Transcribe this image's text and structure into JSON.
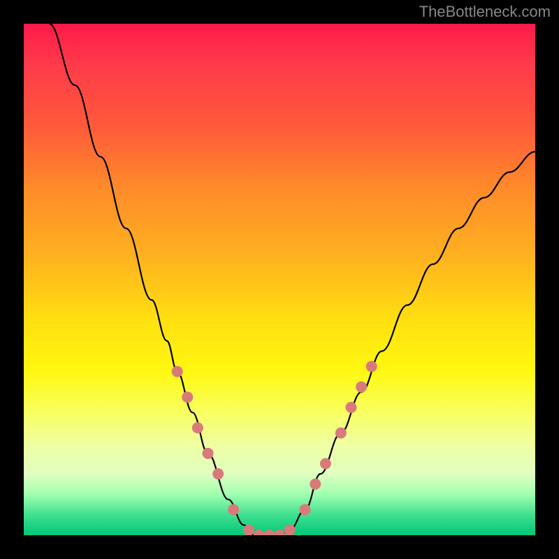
{
  "watermark": "TheBottleneck.com",
  "chart_data": {
    "type": "line",
    "title": "",
    "xlabel": "",
    "ylabel": "",
    "xlim": [
      0,
      100
    ],
    "ylim": [
      0,
      100
    ],
    "gradient_stops": [
      {
        "pos": 0,
        "color": "#ff1a4a"
      },
      {
        "pos": 20,
        "color": "#ff5a3a"
      },
      {
        "pos": 45,
        "color": "#ffb020"
      },
      {
        "pos": 68,
        "color": "#fff810"
      },
      {
        "pos": 88,
        "color": "#e0ffc0"
      },
      {
        "pos": 100,
        "color": "#00c878"
      }
    ],
    "series": [
      {
        "name": "bottleneck-curve",
        "color": "#000000",
        "x": [
          5,
          10,
          15,
          20,
          25,
          28,
          30,
          33,
          36,
          40,
          43,
          45,
          48,
          50,
          52,
          55,
          58,
          62,
          66,
          70,
          75,
          80,
          85,
          90,
          95,
          100
        ],
        "y": [
          100,
          88,
          74,
          60,
          46,
          38,
          32,
          24,
          16,
          7,
          2,
          0,
          0,
          0,
          1,
          5,
          12,
          20,
          28,
          36,
          45,
          53,
          60,
          66,
          71,
          75
        ]
      }
    ],
    "markers": {
      "name": "highlight-dots",
      "color": "#d97a7a",
      "radius": 8,
      "points": [
        {
          "x": 30,
          "y": 32
        },
        {
          "x": 32,
          "y": 27
        },
        {
          "x": 34,
          "y": 21
        },
        {
          "x": 36,
          "y": 16
        },
        {
          "x": 38,
          "y": 12
        },
        {
          "x": 41,
          "y": 5
        },
        {
          "x": 44,
          "y": 1
        },
        {
          "x": 46,
          "y": 0
        },
        {
          "x": 48,
          "y": 0
        },
        {
          "x": 50,
          "y": 0
        },
        {
          "x": 52,
          "y": 1
        },
        {
          "x": 55,
          "y": 5
        },
        {
          "x": 57,
          "y": 10
        },
        {
          "x": 59,
          "y": 14
        },
        {
          "x": 62,
          "y": 20
        },
        {
          "x": 64,
          "y": 25
        },
        {
          "x": 66,
          "y": 29
        },
        {
          "x": 68,
          "y": 33
        }
      ]
    }
  }
}
